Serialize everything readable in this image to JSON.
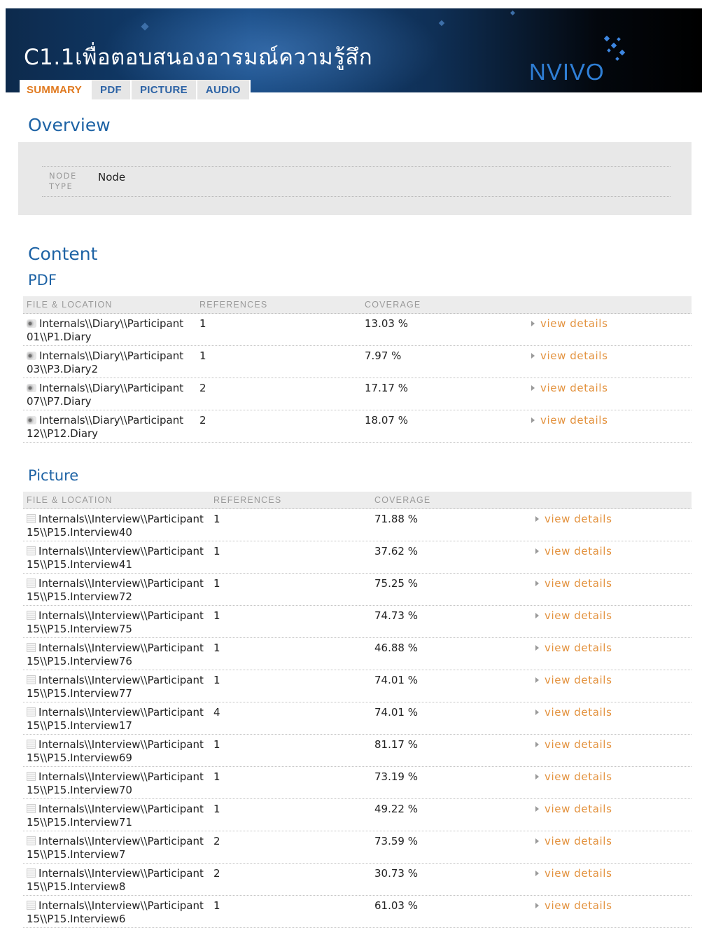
{
  "header": {
    "title": "C1.1เพื่อตอบสนองอารมณ์ความรู้สึก",
    "logo_text": "NVIVO",
    "tabs": [
      {
        "label": "SUMMARY",
        "active": true
      },
      {
        "label": "PDF",
        "active": false
      },
      {
        "label": "PICTURE",
        "active": false
      },
      {
        "label": "AUDIO",
        "active": false
      }
    ]
  },
  "overview": {
    "heading": "Overview",
    "node_type_label": "NODE TYPE",
    "node_type_value": "Node"
  },
  "content": {
    "heading": "Content",
    "pdf": {
      "heading": "PDF",
      "columns": [
        "FILE & LOCATION",
        "REFERENCES",
        "COVERAGE"
      ],
      "rows": [
        {
          "file_line1": "Internals\\\\Diary\\\\Participant",
          "file_line2": "01\\\\P1.Diary",
          "references": "1",
          "coverage": "13.03 %",
          "link": "view details"
        },
        {
          "file_line1": "Internals\\\\Diary\\\\Participant",
          "file_line2": "03\\\\P3.Diary2",
          "references": "1",
          "coverage": "7.97 %",
          "link": "view details"
        },
        {
          "file_line1": "Internals\\\\Diary\\\\Participant",
          "file_line2": "07\\\\P7.Diary",
          "references": "2",
          "coverage": "17.17 %",
          "link": "view details"
        },
        {
          "file_line1": "Internals\\\\Diary\\\\Participant",
          "file_line2": "12\\\\P12.Diary",
          "references": "2",
          "coverage": "18.07 %",
          "link": "view details"
        }
      ]
    },
    "picture": {
      "heading": "Picture",
      "columns": [
        "FILE & LOCATION",
        "REFERENCES",
        "COVERAGE"
      ],
      "rows": [
        {
          "file_line1": "Internals\\\\Interview\\\\Participant",
          "file_line2": "15\\\\P15.Interview40",
          "references": "1",
          "coverage": "71.88 %",
          "link": "view details"
        },
        {
          "file_line1": "Internals\\\\Interview\\\\Participant",
          "file_line2": "15\\\\P15.Interview41",
          "references": "1",
          "coverage": "37.62 %",
          "link": "view details"
        },
        {
          "file_line1": "Internals\\\\Interview\\\\Participant",
          "file_line2": "15\\\\P15.Interview72",
          "references": "1",
          "coverage": "75.25 %",
          "link": "view details"
        },
        {
          "file_line1": "Internals\\\\Interview\\\\Participant",
          "file_line2": "15\\\\P15.Interview75",
          "references": "1",
          "coverage": "74.73 %",
          "link": "view details"
        },
        {
          "file_line1": "Internals\\\\Interview\\\\Participant",
          "file_line2": "15\\\\P15.Interview76",
          "references": "1",
          "coverage": "46.88 %",
          "link": "view details"
        },
        {
          "file_line1": "Internals\\\\Interview\\\\Participant",
          "file_line2": "15\\\\P15.Interview77",
          "references": "1",
          "coverage": "74.01 %",
          "link": "view details"
        },
        {
          "file_line1": "Internals\\\\Interview\\\\Participant",
          "file_line2": "15\\\\P15.Interview17",
          "references": "4",
          "coverage": "74.01 %",
          "link": "view details"
        },
        {
          "file_line1": "Internals\\\\Interview\\\\Participant",
          "file_line2": "15\\\\P15.Interview69",
          "references": "1",
          "coverage": "81.17 %",
          "link": "view details"
        },
        {
          "file_line1": "Internals\\\\Interview\\\\Participant",
          "file_line2": "15\\\\P15.Interview70",
          "references": "1",
          "coverage": "73.19 %",
          "link": "view details"
        },
        {
          "file_line1": "Internals\\\\Interview\\\\Participant",
          "file_line2": "15\\\\P15.Interview71",
          "references": "1",
          "coverage": "49.22 %",
          "link": "view details"
        },
        {
          "file_line1": "Internals\\\\Interview\\\\Participant",
          "file_line2": "15\\\\P15.Interview7",
          "references": "2",
          "coverage": "73.59 %",
          "link": "view details"
        },
        {
          "file_line1": "Internals\\\\Interview\\\\Participant",
          "file_line2": "15\\\\P15.Interview8",
          "references": "2",
          "coverage": "30.73 %",
          "link": "view details"
        },
        {
          "file_line1": "Internals\\\\Interview\\\\Participant",
          "file_line2": "15\\\\P15.Interview6",
          "references": "1",
          "coverage": "61.03 %",
          "link": "view details"
        }
      ]
    }
  },
  "colors": {
    "heading_blue": "#1e63a5",
    "link_orange": "#e3923e",
    "active_tab": "#e07a20"
  }
}
